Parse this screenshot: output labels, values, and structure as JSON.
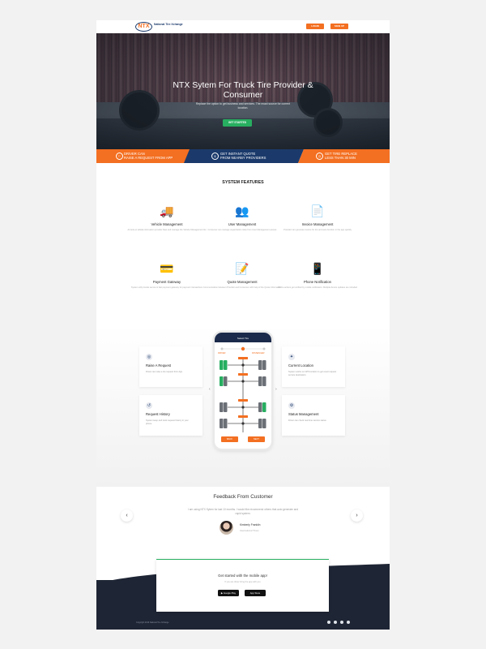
{
  "nav": {
    "logo_mark": "NTX",
    "logo_text": "National Tire Xchange",
    "btn_login": "LOGIN",
    "btn_signup": "SIGN UP"
  },
  "hero": {
    "title": "NTX Sytem For Truck Tire Provider & Consumer",
    "subtitle": "Replace the option to get business and services. The exact source for current location.",
    "cta": "GET STARTED"
  },
  "stripe": [
    {
      "line1": "DRIVER CAN",
      "line2": "RAISE A REQUEST FROM APP",
      "color": "#f36f21"
    },
    {
      "line1": "GET INSTANT QUOTE",
      "line2": "FROM NEARBY PROVIDERS",
      "color": "#1b3a6b"
    },
    {
      "line1": "GET TIRE REPLACE",
      "line2": "LESS THAN 30 MIN",
      "color": "#f36f21"
    }
  ],
  "features": {
    "title": "SYSTEM FEATURES",
    "items": [
      {
        "icon": "truck-icon",
        "glyph": "🚚",
        "title": "Vehicle Management",
        "desc": "Ali teria et tabida information provider fleet and manage the Vehicle Management list"
      },
      {
        "icon": "users-icon",
        "glyph": "👥",
        "title": "User Management",
        "desc": "Consumer can manage organization roles from User Management access"
      },
      {
        "icon": "invoice-icon",
        "glyph": "📄",
        "title": "Invoice Management",
        "desc": "Provider can generate invoice for tire and auto function in the app quickly"
      },
      {
        "icon": "payment-icon",
        "glyph": "💳",
        "title": "Payment Gateway",
        "desc": "System will provide secure & fast payment gateway for payment transactions"
      },
      {
        "icon": "quote-icon",
        "glyph": "📝",
        "title": "Quote Management",
        "desc": "Communication between Provider and Consumer with help of the Quote Information"
      },
      {
        "icon": "phone-notification-icon",
        "glyph": "📱",
        "title": "Phone Notification",
        "desc": "All the actions get notified by mobile notification. Multiple device updates are included"
      }
    ]
  },
  "showcase": {
    "cards": [
      {
        "icon": "request-icon",
        "glyph": "◎",
        "title": "Raise A Request",
        "desc": "Driver can raise a tire request from App."
      },
      {
        "icon": "history-icon",
        "glyph": "↺",
        "title": "Request History",
        "desc": "System keep and track request history in your phone."
      },
      {
        "icon": "location-icon",
        "glyph": "✦",
        "title": "Current Location",
        "desc": "System works on GPS location to get exact request service destination."
      },
      {
        "icon": "status-icon",
        "glyph": "⚙",
        "title": "Status Management",
        "desc": "Driver can check real time service status."
      }
    ],
    "phone": {
      "header": "Select Tire",
      "left_label": "DRIVER",
      "right_label": "PASSENGER",
      "back": "BACK",
      "next": "NEXT"
    }
  },
  "feedback": {
    "title": "Feedback From Customer",
    "quote": "I am using NTX Sytem for last 10 months. I would like recommend others that auto generate and rapid system.",
    "name": "Kimberly Franklin",
    "role": "International Times"
  },
  "cta": {
    "title": "Get started with the mobile app!",
    "subtitle": "If you are driver bring the app with you",
    "google_play": "Google Play",
    "app_store": "App Store"
  },
  "footer": {
    "copyright": "Copyright 2019 National Tire Xchange"
  }
}
